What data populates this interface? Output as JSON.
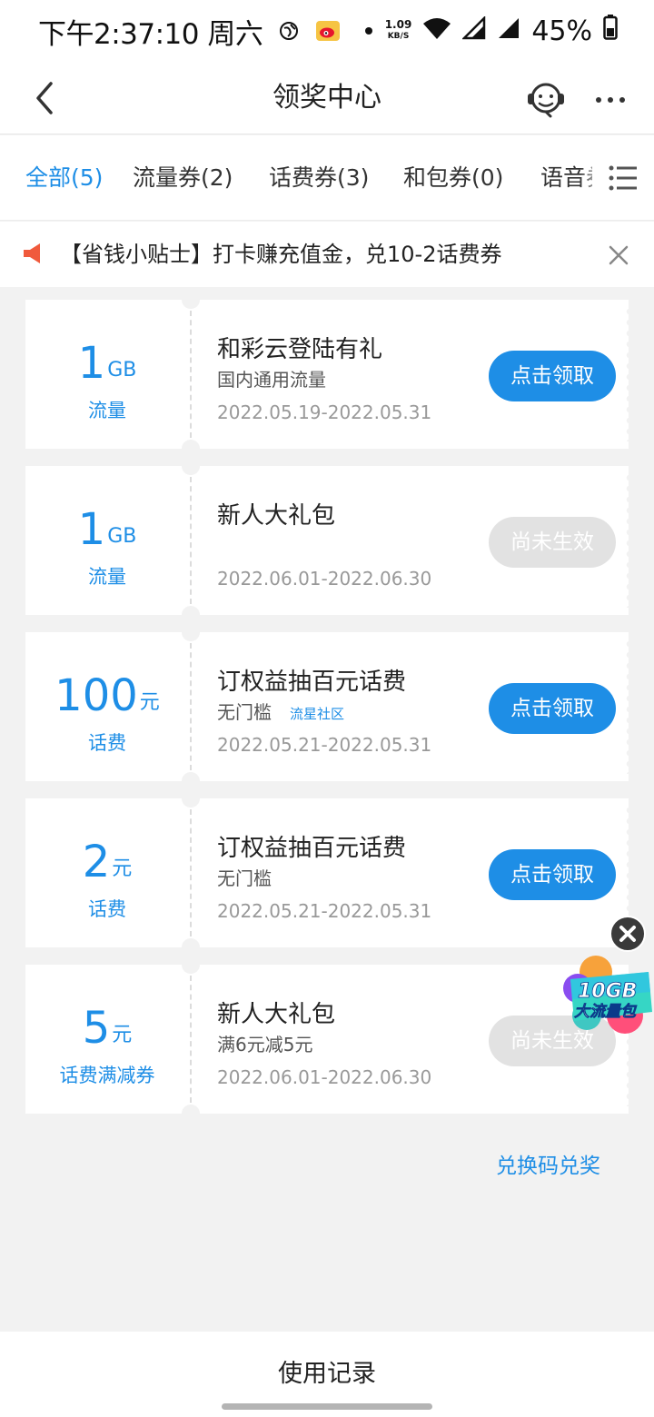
{
  "status_bar": {
    "time": "下午2:37:10 周六",
    "net_speed_value": "1.09",
    "net_speed_unit": "KB/S",
    "battery_percent": "45%",
    "icons": [
      "globe-icon",
      "weibo-icon",
      "dot-icon",
      "wifi-icon",
      "signal-icon",
      "signal-icon",
      "battery-icon"
    ]
  },
  "nav": {
    "title": "领奖中心",
    "icons": [
      "back-arrow-icon",
      "customer-service-icon",
      "more-dots-icon"
    ]
  },
  "tabs": [
    {
      "label": "全部(5)",
      "active": true
    },
    {
      "label": "流量券(2)",
      "active": false
    },
    {
      "label": "话费券(3)",
      "active": false
    },
    {
      "label": "和包券(0)",
      "active": false
    },
    {
      "label": "语音券",
      "active": false
    }
  ],
  "notice": {
    "text": "【省钱小贴士】打卡赚充值金，兑10-2话费券",
    "icons": [
      "speaker-icon",
      "close-icon"
    ]
  },
  "coupons": [
    {
      "amount": "1",
      "unit": "GB",
      "type": "流量",
      "title": "和彩云登陆有礼",
      "subtitle": "国内通用流量",
      "tag": "",
      "date": "2022.05.19-2022.05.31",
      "button": "点击领取",
      "button_state": "active"
    },
    {
      "amount": "1",
      "unit": "GB",
      "type": "流量",
      "title": "新人大礼包",
      "subtitle": "",
      "tag": "",
      "date": "2022.06.01-2022.06.30",
      "button": "尚未生效",
      "button_state": "disabled"
    },
    {
      "amount": "100",
      "unit": "元",
      "type": "话费",
      "title": "订权益抽百元话费",
      "subtitle": "无门槛",
      "tag": "流星社区",
      "date": "2022.05.21-2022.05.31",
      "button": "点击领取",
      "button_state": "active"
    },
    {
      "amount": "2",
      "unit": "元",
      "type": "话费",
      "title": "订权益抽百元话费",
      "subtitle": "无门槛",
      "tag": "",
      "date": "2022.05.21-2022.05.31",
      "button": "点击领取",
      "button_state": "active"
    },
    {
      "amount": "5",
      "unit": "元",
      "type": "话费满减券",
      "title": "新人大礼包",
      "subtitle": "满6元减5元",
      "tag": "",
      "date": "2022.06.01-2022.06.30",
      "button": "尚未生效",
      "button_state": "disabled"
    }
  ],
  "redeem_link": "兑换码兑奖",
  "promo": {
    "badge_line1": "10GB",
    "badge_line2": "大流量包",
    "icons": [
      "close-circle-icon",
      "promo-badge-icon"
    ]
  },
  "bottom": {
    "label": "使用记录"
  },
  "colors": {
    "accent": "#1e8ee6",
    "background": "#f2f2f2",
    "card": "#ffffff",
    "disabled_button": "#e2e2e2",
    "notice_icon": "#f05a3c"
  }
}
